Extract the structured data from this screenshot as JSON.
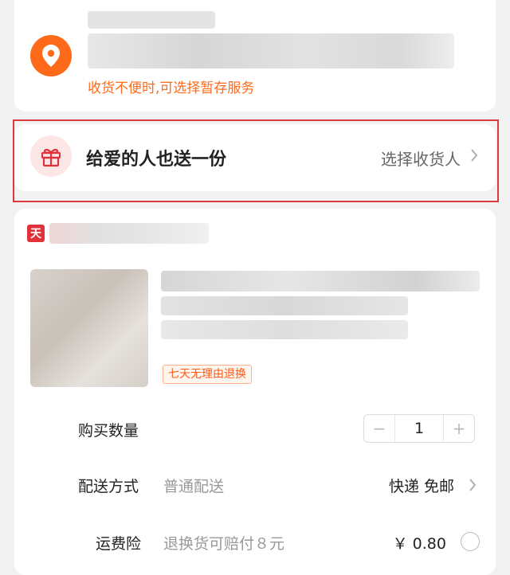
{
  "address": {
    "note": "收货不便时,可选择暂存服务"
  },
  "gift": {
    "title": "给爱的人也送一份",
    "action": "选择收货人"
  },
  "shop": {
    "badge": "天"
  },
  "item": {
    "tag": "七天无理由退换"
  },
  "quantity": {
    "label": "购买数量",
    "minus": "−",
    "value": "1",
    "plus": "+"
  },
  "shipping": {
    "label": "配送方式",
    "method": "普通配送",
    "value": "快递 免邮"
  },
  "insurance": {
    "label": "运费险",
    "desc": "退换货可赔付８元",
    "price": "￥ 0.80"
  },
  "colors": {
    "accent": "#ff6a1a",
    "highlight_border": "#d9393d"
  }
}
